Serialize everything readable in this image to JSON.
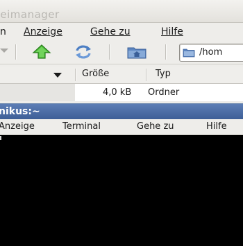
{
  "file_manager": {
    "title": "teimanager",
    "menu": [
      {
        "label": "n",
        "mnemonic_index": -1
      },
      {
        "label": "Anzeige"
      },
      {
        "label": "Gehe zu"
      },
      {
        "label": "Hilfe"
      }
    ],
    "toolbar": {
      "up_icon": "up-arrow-icon",
      "reload_icon": "reload-icon",
      "home_icon": "folder-home-icon"
    },
    "location": "/hom",
    "columns": {
      "name_header": "",
      "size_header": "Größe",
      "type_header": "Typ"
    },
    "rows": [
      {
        "name": "",
        "size": "4,0 kB",
        "type": "Ordner"
      }
    ]
  },
  "terminal": {
    "title": "nikus:~",
    "menu": [
      "Anzeige",
      "Terminal",
      "Gehe zu",
      "Hilfe"
    ]
  },
  "colors": {
    "terminal_titlebar": "#4a6aa3",
    "terminal_background": "#000000",
    "toolbar_green": "#3aa82e",
    "folder_blue": "#5d86c1"
  }
}
